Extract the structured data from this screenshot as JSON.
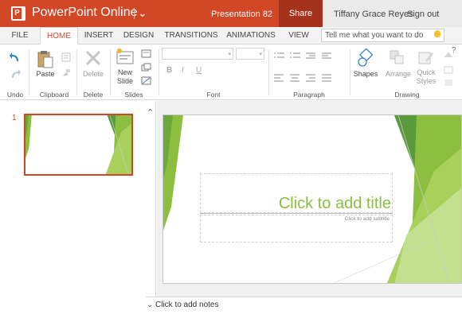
{
  "app": {
    "name": "PowerPoint Online",
    "document": "Presentation 82",
    "share_label": "Share",
    "user_name": "Tiffany Grace Reyes",
    "sign_out_label": "Sign out"
  },
  "tabs": [
    {
      "label": "FILE",
      "active": false
    },
    {
      "label": "HOME",
      "active": true
    },
    {
      "label": "INSERT",
      "active": false
    },
    {
      "label": "DESIGN",
      "active": false
    },
    {
      "label": "TRANSITIONS",
      "active": false
    },
    {
      "label": "ANIMATIONS",
      "active": false
    },
    {
      "label": "VIEW",
      "active": false
    }
  ],
  "tell_me": {
    "placeholder": "Tell me what you want to do"
  },
  "ribbon": {
    "undo_group": {
      "label": "Undo"
    },
    "clipboard": {
      "label": "Clipboard",
      "paste": "Paste"
    },
    "delete_group": {
      "label": "Delete",
      "delete": "Delete"
    },
    "slides": {
      "label": "Slides",
      "new_slide_line1": "New",
      "new_slide_line2": "Slide"
    },
    "font": {
      "label": "Font",
      "bold": "B",
      "italic": "I",
      "underline": "U"
    },
    "paragraph": {
      "label": "Paragraph"
    },
    "drawing": {
      "label": "Drawing",
      "shapes": "Shapes",
      "arrange": "Arrange",
      "quick_styles_line1": "Quick",
      "quick_styles_line2": "Styles"
    }
  },
  "slides_panel": {
    "slide_number": "1"
  },
  "slide": {
    "title_placeholder": "Click to add title",
    "subtitle_placeholder": "Click to add subtitle"
  },
  "notes": {
    "label": "Click to add notes"
  },
  "colors": {
    "brand": "#d24726",
    "share_bg": "#a5321a",
    "theme_green": "#8cbf3f",
    "theme_dark_green": "#5a9a3a"
  },
  "icons": [
    "undo-icon",
    "redo-icon",
    "paste-icon",
    "cut-icon",
    "format-painter-icon",
    "delete-icon",
    "new-slide-icon",
    "layout-icon",
    "duplicate-slide-icon",
    "hide-slide-icon",
    "bullets-icon",
    "numbering-icon",
    "shapes-icon",
    "arrange-icon",
    "quick-styles-icon",
    "help-icon",
    "lightbulb-icon"
  ]
}
